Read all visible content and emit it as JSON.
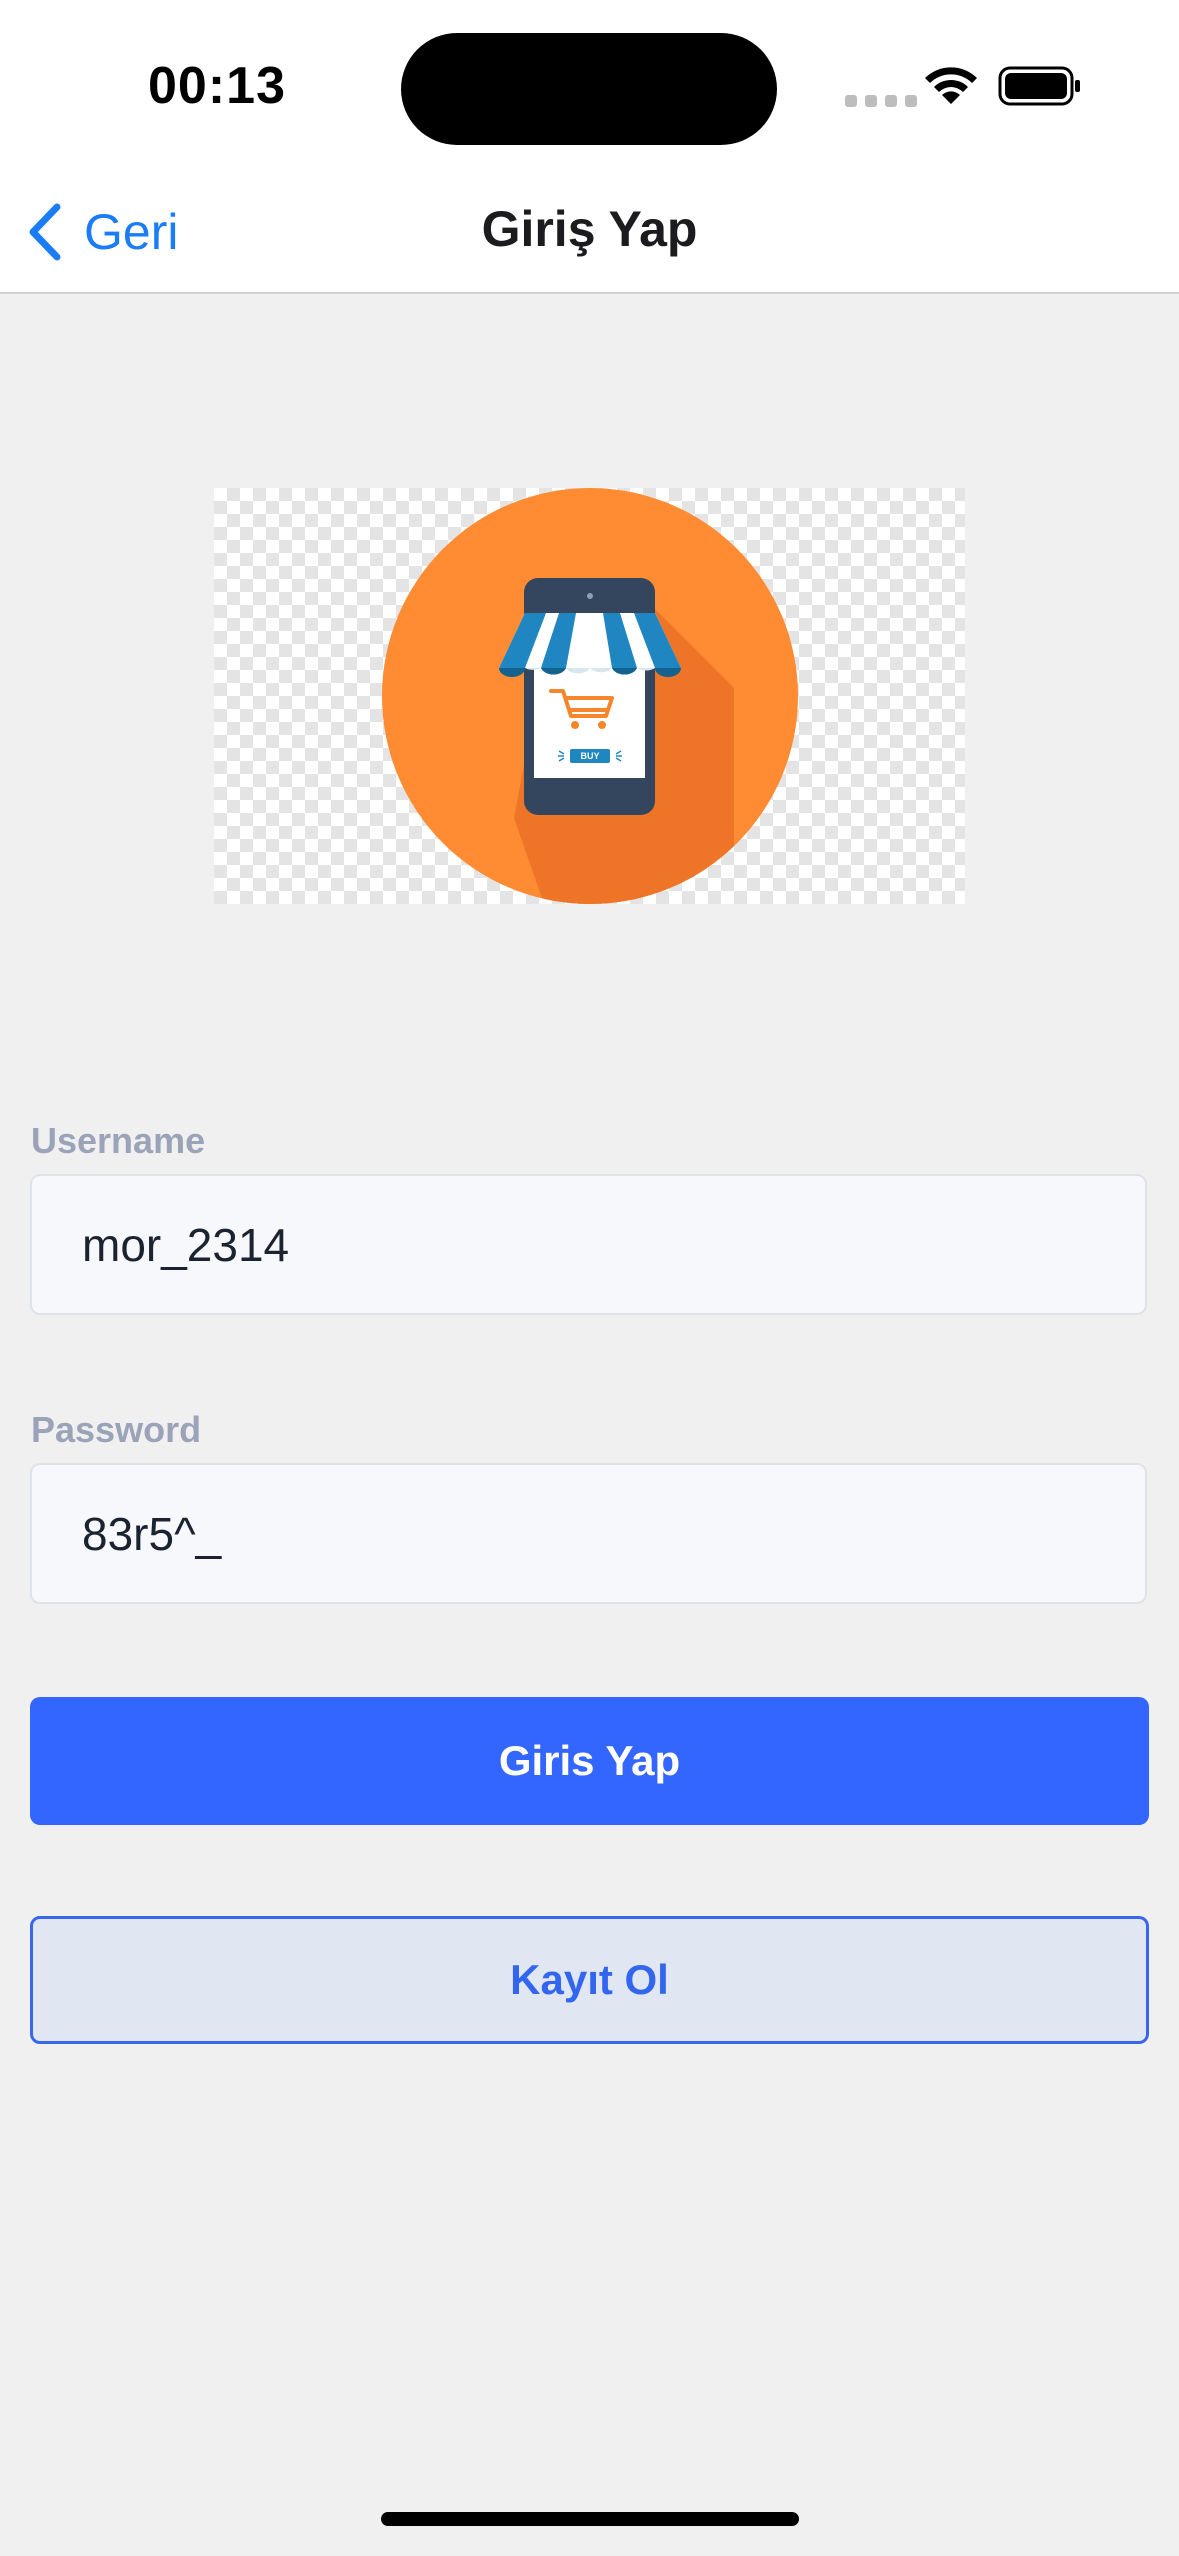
{
  "status_bar": {
    "time": "00:13",
    "icons": [
      "cellular-icon",
      "wifi-icon",
      "battery-icon"
    ]
  },
  "nav": {
    "back_label": "Geri",
    "title": "Giriş Yap"
  },
  "logo": {
    "icon": "mobile-shop-cart-logo",
    "buy_label": "BUY",
    "colors": {
      "circle": "#ff8c33",
      "shadow": "#ee7528",
      "phone": "#34465e",
      "awning_blue": "#1f86c2",
      "cart": "#f7862a"
    }
  },
  "form": {
    "username_label": "Username",
    "username_value": "mor_2314",
    "password_label": "Password",
    "password_value": "83r5^_"
  },
  "buttons": {
    "login_label": "Giris Yap",
    "register_label": "Kayıt Ol"
  },
  "colors": {
    "accent": "#3366ff",
    "link": "#1a7cf6",
    "background": "#f0f0f0"
  }
}
